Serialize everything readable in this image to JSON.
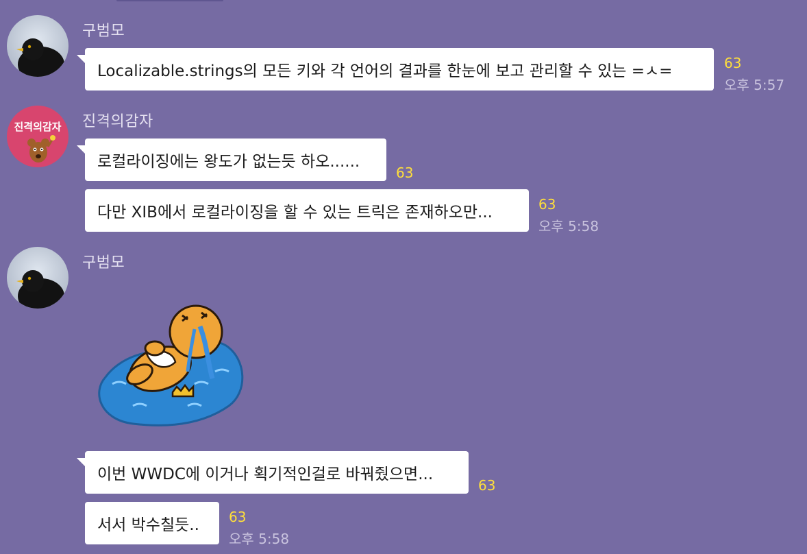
{
  "chat": {
    "groups": [
      {
        "sender": "구범모",
        "messages": [
          {
            "text": "Localizable.strings의 모든 키와 각 언어의 결과를 한눈에 보고 관리할 수 있는 =ㅅ=",
            "unread": "63",
            "time": "오후 5:57"
          }
        ]
      },
      {
        "sender": "진격의감자",
        "avatar_text": "진격의감자",
        "messages": [
          {
            "text": "로컬라이징에는 왕도가 없는듯 하오......",
            "unread": "63"
          },
          {
            "text": "다만 XIB에서 로컬라이징을 할 수 있는 트릭은 존재하오만...",
            "unread": "63",
            "time": "오후 5:58"
          }
        ]
      },
      {
        "sender": "구범모",
        "sticker": "crying-lion-floating-sticker",
        "messages": [
          {
            "text": "이번 WWDC에 이거나 획기적인걸로 바꿔줬으면...",
            "unread": "63"
          },
          {
            "text": "서서 박수칠듯..",
            "unread": "63",
            "time": "오후 5:58"
          }
        ]
      }
    ]
  },
  "colors": {
    "background": "#766ba3",
    "bubble": "#ffffff",
    "unread": "#ffdf3b",
    "time": "#c9c3de",
    "sender": "#e4e0f0"
  },
  "icons": {
    "avatar_1": "blackbird-avatar",
    "avatar_2": "potato-character-avatar",
    "avatar_3": "blackbird-avatar"
  }
}
